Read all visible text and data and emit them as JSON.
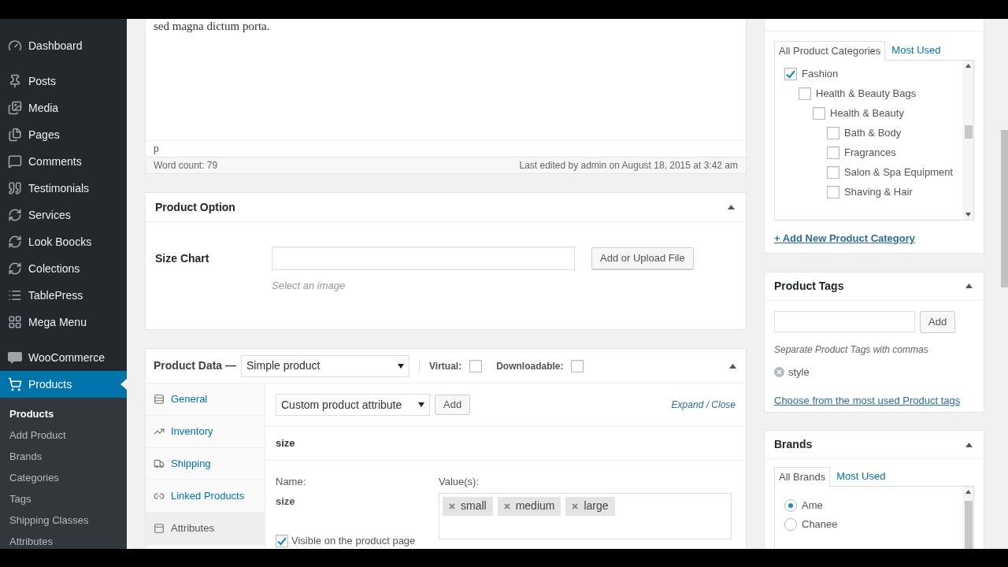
{
  "sidebar": {
    "items": [
      {
        "label": "Dashboard",
        "selected": false
      },
      {
        "label": "Posts",
        "selected": false
      },
      {
        "label": "Media",
        "selected": false
      },
      {
        "label": "Pages",
        "selected": false
      },
      {
        "label": "Comments",
        "selected": false
      },
      {
        "label": "Testimonials",
        "selected": false
      },
      {
        "label": "Services",
        "selected": false
      },
      {
        "label": "Look Boocks",
        "selected": false
      },
      {
        "label": "Colections",
        "selected": false
      },
      {
        "label": "TablePress",
        "selected": false
      },
      {
        "label": "Mega Menu",
        "selected": false
      },
      {
        "label": "WooCommerce",
        "selected": false
      },
      {
        "label": "Products",
        "selected": true
      }
    ],
    "submenu": [
      {
        "label": "Products",
        "selected": true
      },
      {
        "label": "Add Product",
        "selected": false
      },
      {
        "label": "Brands",
        "selected": false
      },
      {
        "label": "Categories",
        "selected": false
      },
      {
        "label": "Tags",
        "selected": false
      },
      {
        "label": "Shipping Classes",
        "selected": false
      },
      {
        "label": "Attributes",
        "selected": false
      }
    ]
  },
  "editor": {
    "text": "sed magna dictum porta.",
    "path": "p",
    "word_count": "Word count: 79",
    "last_edited": "Last edited by admin on August 18, 2015 at 3:42 am"
  },
  "product_option": {
    "title": "Product Option",
    "field_label": "Size Chart",
    "button": "Add or Upload File",
    "hint": "Select an image"
  },
  "product_data": {
    "title": "Product Data —",
    "type_select": "Simple product",
    "options": [
      {
        "label": "Virtual:",
        "checked": false
      },
      {
        "label": "Downloadable:",
        "checked": false
      }
    ],
    "tabs": [
      {
        "label": "General",
        "selected": false
      },
      {
        "label": "Inventory",
        "selected": false
      },
      {
        "label": "Shipping",
        "selected": false
      },
      {
        "label": "Linked Products",
        "selected": false
      },
      {
        "label": "Attributes",
        "selected": true
      }
    ],
    "attribute_select": "Custom product attribute",
    "add_button": "Add",
    "expand_close": "Expand / Close",
    "attribute": {
      "heading": "size",
      "name_label": "Name:",
      "name": "size",
      "values_label": "Value(s):",
      "values": [
        "small",
        "medium",
        "large"
      ],
      "visible": {
        "label": "Visible on the product page",
        "checked": true
      }
    }
  },
  "categories": {
    "tabs": [
      {
        "label": "All Product Categories",
        "selected": true
      },
      {
        "label": "Most Used",
        "selected": false
      }
    ],
    "items": [
      {
        "label": "Fashion",
        "checked": true,
        "children": [
          {
            "label": "Health & Beauty Bags",
            "checked": false,
            "children": [
              {
                "label": "Health & Beauty",
                "checked": false,
                "children": [
                  {
                    "label": "Bath & Body",
                    "checked": false
                  },
                  {
                    "label": "Fragrances",
                    "checked": false
                  },
                  {
                    "label": "Salon & Spa Equipment",
                    "checked": false
                  },
                  {
                    "label": "Shaving & Hair",
                    "checked": false
                  }
                ]
              }
            ]
          }
        ]
      }
    ],
    "add_link": "+ Add New Product Category"
  },
  "tags": {
    "title": "Product Tags",
    "add_button": "Add",
    "hint": "Separate Product Tags with commas",
    "tags": [
      "style"
    ],
    "link": "Choose from the most used Product tags"
  },
  "brands": {
    "title": "Brands",
    "tabs": [
      {
        "label": "All Brands",
        "selected": true
      },
      {
        "label": "Most Used",
        "selected": false
      }
    ],
    "items": [
      {
        "label": "Ame",
        "selected": true
      },
      {
        "label": "Chanee",
        "selected": false
      }
    ]
  }
}
